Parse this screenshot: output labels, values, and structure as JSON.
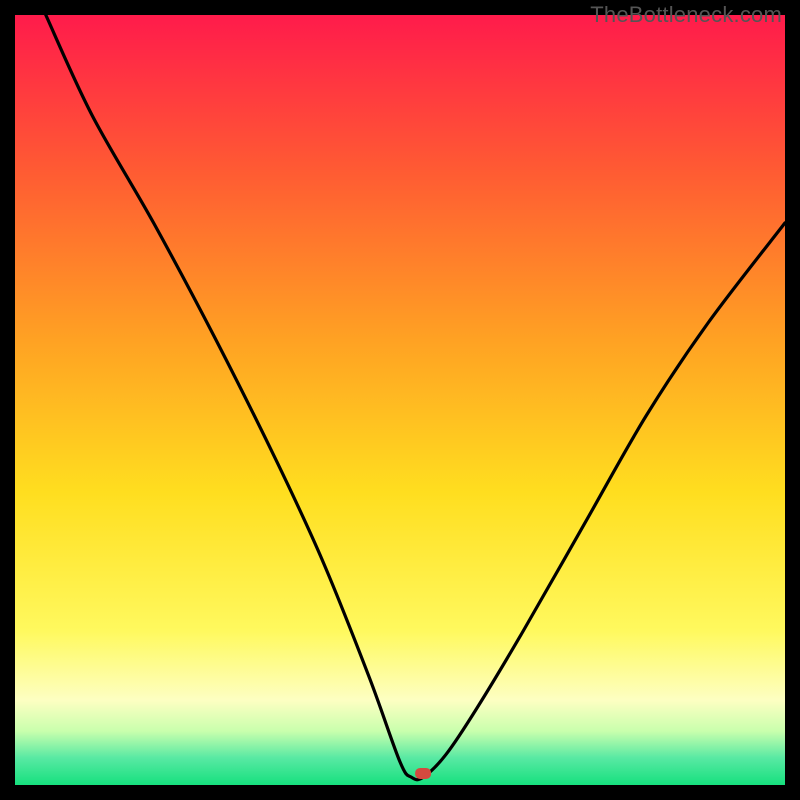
{
  "watermark": "TheBottleneck.com",
  "chart_data": {
    "type": "line",
    "title": "",
    "xlabel": "",
    "ylabel": "",
    "xlim": [
      0,
      100
    ],
    "ylim": [
      0,
      100
    ],
    "grid": false,
    "legend": false,
    "gradient_stops": [
      {
        "pos": 0.0,
        "color": "#ff1b4b"
      },
      {
        "pos": 0.2,
        "color": "#ff5a33"
      },
      {
        "pos": 0.42,
        "color": "#ffa123"
      },
      {
        "pos": 0.62,
        "color": "#ffde1f"
      },
      {
        "pos": 0.8,
        "color": "#fff95e"
      },
      {
        "pos": 0.89,
        "color": "#fdffc2"
      },
      {
        "pos": 0.93,
        "color": "#c9ffad"
      },
      {
        "pos": 0.965,
        "color": "#58e9a3"
      },
      {
        "pos": 1.0,
        "color": "#16e07e"
      }
    ],
    "series": [
      {
        "name": "bottleneck-curve",
        "x": [
          4,
          10,
          18,
          26,
          34,
          40,
          46,
          50,
          51.5,
          53,
          56,
          60,
          66,
          74,
          82,
          90,
          100
        ],
        "y": [
          100,
          87,
          73,
          58,
          42,
          29,
          14,
          3,
          1,
          1,
          4,
          10,
          20,
          34,
          48,
          60,
          73
        ]
      }
    ],
    "marker": {
      "x": 53,
      "y": 1.5,
      "color": "#d44a3f"
    }
  }
}
